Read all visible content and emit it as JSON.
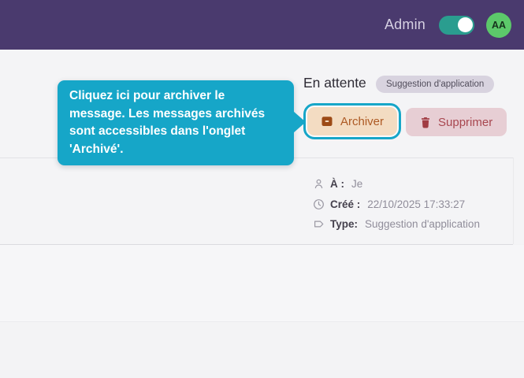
{
  "header": {
    "admin_label": "Admin",
    "toggle_state": "on",
    "avatar_initials": "AA"
  },
  "tooltip": {
    "text": "Cliquez ici pour archiver le message. Les messages archivés sont accessibles dans l'onglet 'Archivé'."
  },
  "message": {
    "status": "En attente",
    "type_badge": "Suggestion d'application",
    "actions": {
      "archive_label": "Archiver",
      "delete_label": "Supprimer"
    },
    "meta": [
      {
        "icon": "person-icon",
        "label": "À :",
        "value": "Je"
      },
      {
        "icon": "clock-icon",
        "label": "Créé :",
        "value": "22/10/2025 17:33:27"
      },
      {
        "icon": "tag-icon",
        "label": "Type:",
        "value": "Suggestion d'application"
      }
    ]
  },
  "colors": {
    "header_bg": "#4a3a6e",
    "accent_cyan": "#16a6c8",
    "toggle_on_green": "#2a9d8f",
    "avatar_green": "#5cc96a",
    "archive_button_bg": "#f3dcc2",
    "archive_button_text": "#ad5a24",
    "delete_button_bg": "#e7ced4",
    "delete_button_text": "#a84750",
    "badge_bg": "#d8d3df",
    "content_bg": "#f4f4f6"
  }
}
